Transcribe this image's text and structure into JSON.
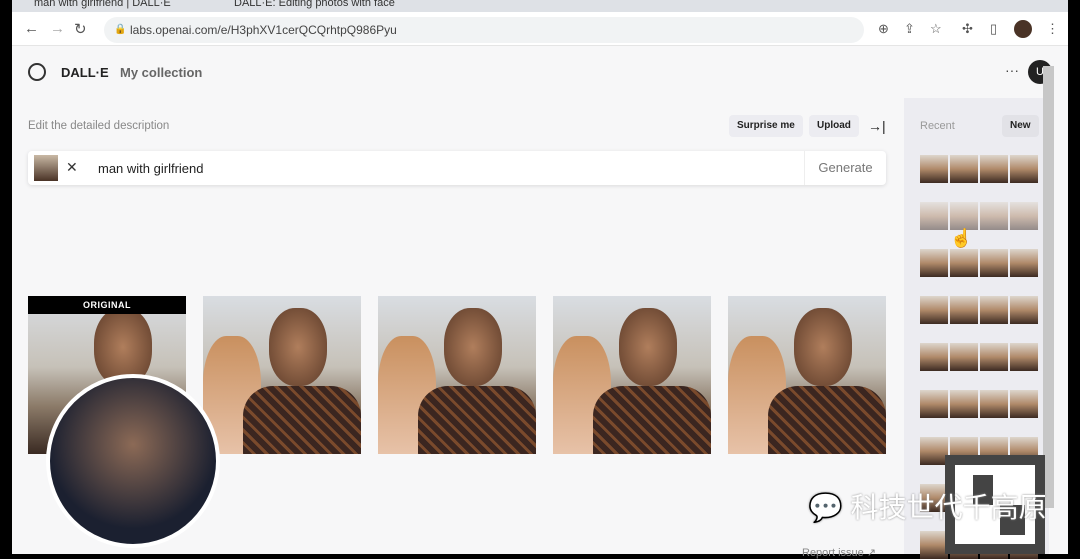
{
  "browser": {
    "tabs": [
      {
        "title": "man with girlfriend | DALL·E"
      },
      {
        "title": "DALL·E: Editing photos with face"
      }
    ],
    "url": "labs.openai.com/e/H3phXV1cerQCQrhtpQ986Pyu"
  },
  "header": {
    "brand": "DALL·E",
    "nav_collection": "My collection",
    "more": "···",
    "avatar_initial": "U"
  },
  "editor": {
    "label": "Edit the detailed description",
    "surprise": "Surprise me",
    "upload": "Upload",
    "prompt": "man with girlfriend",
    "generate": "Generate"
  },
  "results": {
    "original_tag": "ORIGINAL"
  },
  "sidebar": {
    "recent": "Recent",
    "new": "New"
  },
  "footer": {
    "report": "Report issue"
  },
  "watermark": {
    "text": "科技世代千高原"
  }
}
